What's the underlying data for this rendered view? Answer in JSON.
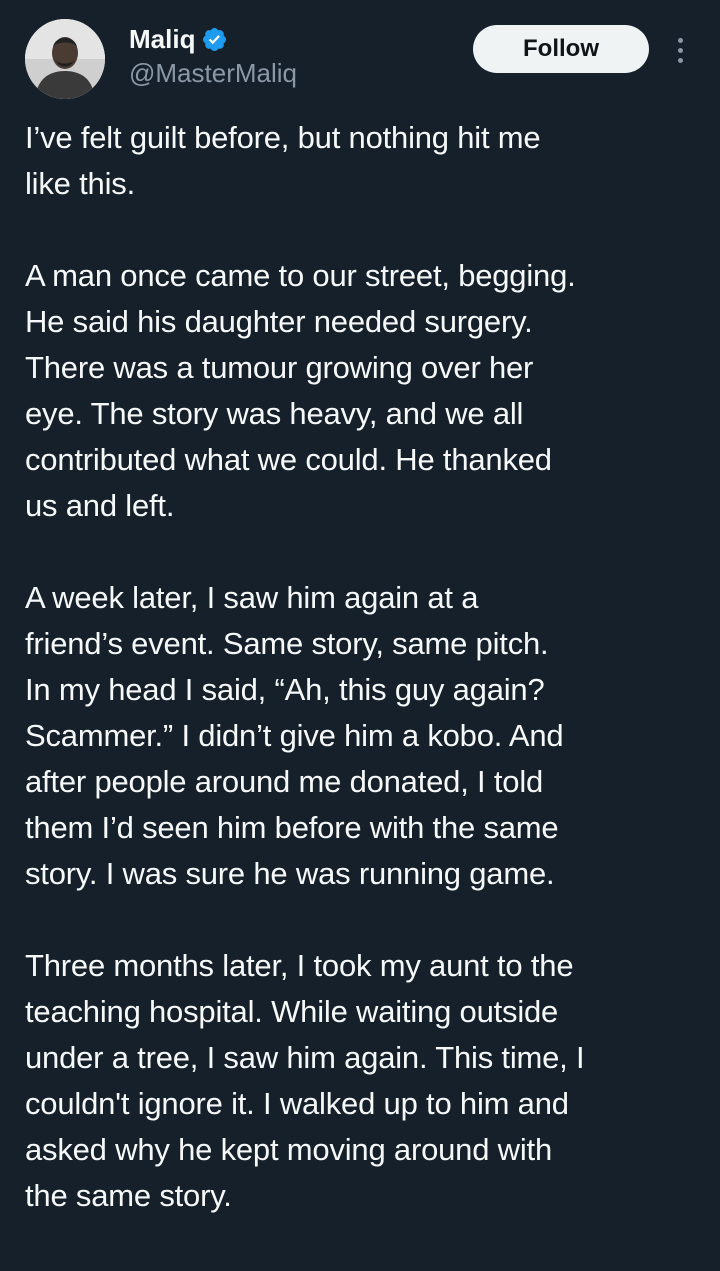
{
  "author": {
    "display_name": "Maliq",
    "handle": "@MasterMaliq",
    "verified": true
  },
  "actions": {
    "follow_label": "Follow"
  },
  "colors": {
    "background": "#15202b",
    "text": "#f7f9f9",
    "secondary_text": "#8b98a5",
    "verified_badge": "#1d9bf0",
    "follow_button_bg": "#eff3f4"
  },
  "icons": {
    "verified": "verified-badge-icon",
    "more": "more-options-icon"
  },
  "tweet": {
    "paragraphs": [
      {
        "lines": [
          "I’ve felt guilt before, but nothing hit me",
          "like this."
        ]
      },
      {
        "lines": [
          "A man once came to our street, begging.",
          "He said his daughter needed surgery.",
          "There was a tumour growing over her",
          "eye. The story was heavy, and we all",
          "contributed what we could. He thanked",
          "us and left."
        ]
      },
      {
        "lines": [
          "A week later, I saw him again at a",
          "friend’s event. Same story, same pitch.",
          "In my head I said, “Ah, this guy again?",
          "Scammer.” I didn’t give him a kobo. And",
          "after people around me donated, I told",
          "them I’d seen him before with the same",
          "story. I was sure he was running game."
        ]
      },
      {
        "lines": [
          "Three months later, I took my aunt to the",
          "teaching hospital. While waiting outside",
          "under a tree, I saw him again. This time, I",
          "couldn't ignore it. I walked up to him and",
          "asked why he kept moving around with",
          "the same story."
        ]
      }
    ]
  }
}
